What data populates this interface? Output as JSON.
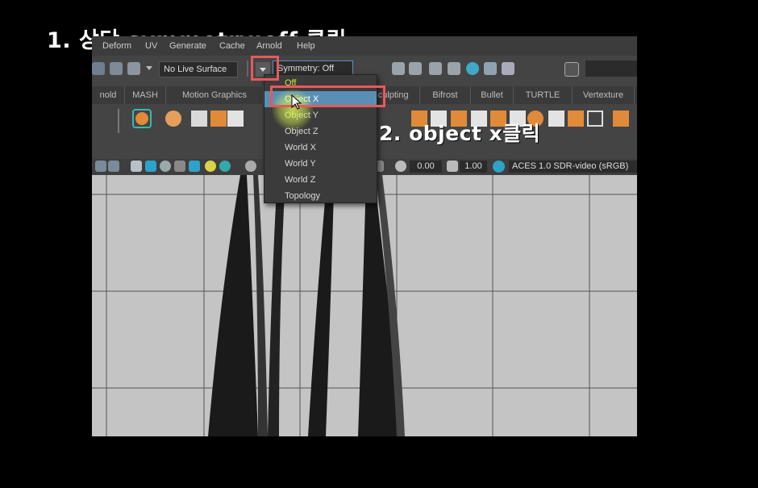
{
  "captions": {
    "step1": "1. 상단 symmetry:off 클릭",
    "step2": "2. object x클릭"
  },
  "menubar": {
    "items": [
      "Deform",
      "UV",
      "Generate",
      "Cache",
      "Arnold",
      "Help"
    ]
  },
  "statusline": {
    "live_surface": "No Live Surface",
    "symmetry_value": "Symmetry: Off",
    "dropdown_arrow_icon": "chevron-down-icon"
  },
  "shelf_tabs": [
    "nold",
    "MASH",
    "Motion Graphics",
    "Sculpting",
    "Bifrost",
    "Bullet",
    "TURTLE",
    "Vertexture"
  ],
  "panel_toolbar": {
    "exposure": "0.00",
    "gamma": "1.00",
    "colorspace": "ACES 1.0 SDR-video (sRGB)"
  },
  "symmetry_menu": {
    "options": [
      "Off",
      "Object X",
      "Object Y",
      "Object Z",
      "World X",
      "World Y",
      "World Z",
      "Topology"
    ],
    "selected": "Object X"
  },
  "colors": {
    "highlight": "#e8585c",
    "selection": "#5a8fb5",
    "cursor_glow": "#d7f050"
  }
}
